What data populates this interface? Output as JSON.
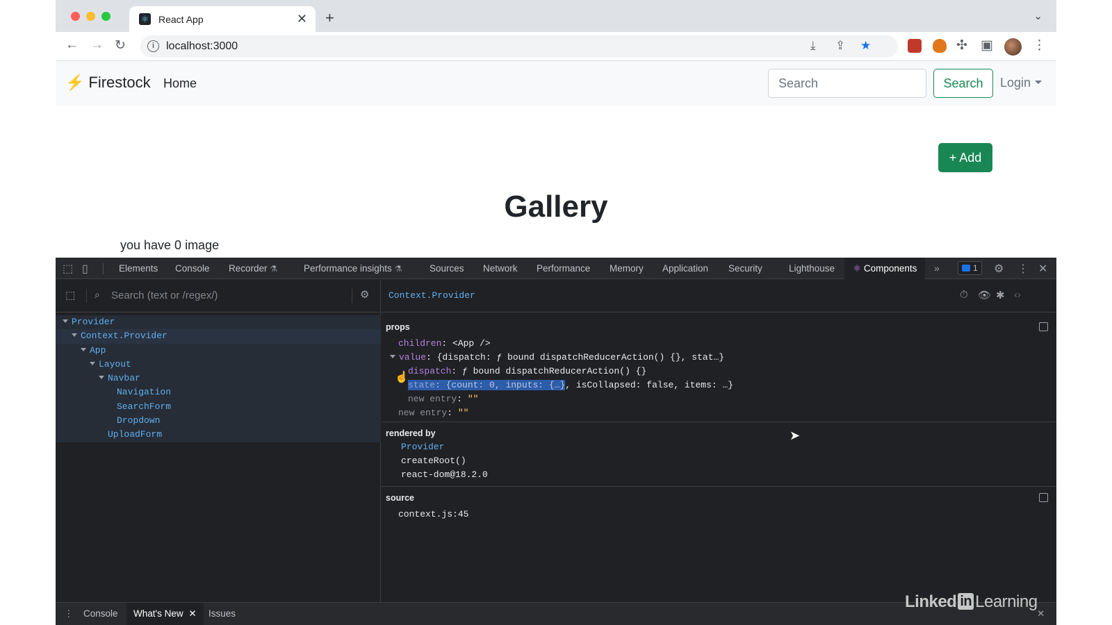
{
  "browser": {
    "tab_title": "React App",
    "tab_close": "✕",
    "new_tab": "+",
    "url": "localhost:3000"
  },
  "app": {
    "brand": "Firestock",
    "nav_home": "Home",
    "search_placeholder": "Search",
    "search_button": "Search",
    "login": "Login",
    "add_button": "+ Add",
    "heading": "Gallery",
    "image_count_text": "you have 0 image"
  },
  "devtools": {
    "tabs": [
      {
        "label": "Elements"
      },
      {
        "label": "Console"
      },
      {
        "label": "Recorder"
      },
      {
        "label": "Performance insights"
      },
      {
        "label": "Sources"
      },
      {
        "label": "Network"
      },
      {
        "label": "Performance"
      },
      {
        "label": "Memory"
      },
      {
        "label": "Application"
      },
      {
        "label": "Security"
      },
      {
        "label": "Lighthouse"
      },
      {
        "label": "Components"
      }
    ],
    "issues_count": "1",
    "search_placeholder": "Search (text or /regex/)",
    "tree": [
      {
        "label": "Provider"
      },
      {
        "label": "Context.Provider"
      },
      {
        "label": "App"
      },
      {
        "label": "Layout"
      },
      {
        "label": "Navbar"
      },
      {
        "label": "Navigation"
      },
      {
        "label": "SearchForm"
      },
      {
        "label": "Dropdown"
      },
      {
        "label": "UploadForm"
      }
    ],
    "selected_component": "Context.Provider",
    "props_label": "props",
    "props": {
      "children_key": "children",
      "children_val": "<App />",
      "value_key": "value",
      "value_val": "{dispatch: ƒ bound dispatchReducerAction() {}, stat…}",
      "dispatch_key": "dispatch",
      "dispatch_val": "ƒ bound dispatchReducerAction() {}",
      "state_key": "state",
      "state_val_hl": "{count: 0, inputs: {…}",
      "state_val_rest": ", isCollapsed: false, items: …}",
      "new_entry_key": "new entry",
      "new_entry_val": "\"\""
    },
    "rendered_by_label": "rendered by",
    "rendered_by": [
      "Provider",
      "createRoot()",
      "react-dom@18.2.0"
    ],
    "source_label": "source",
    "source_file": "context.js:45",
    "drawer_tabs": [
      {
        "label": "Console"
      },
      {
        "label": "What's New"
      },
      {
        "label": "Issues"
      }
    ]
  },
  "watermark": {
    "pre": "Linked",
    "in": "in",
    "post": "Learning"
  },
  "colors": {
    "accent_green": "#198754",
    "devtools_bg": "#202124",
    "component_blue": "#61afef"
  }
}
